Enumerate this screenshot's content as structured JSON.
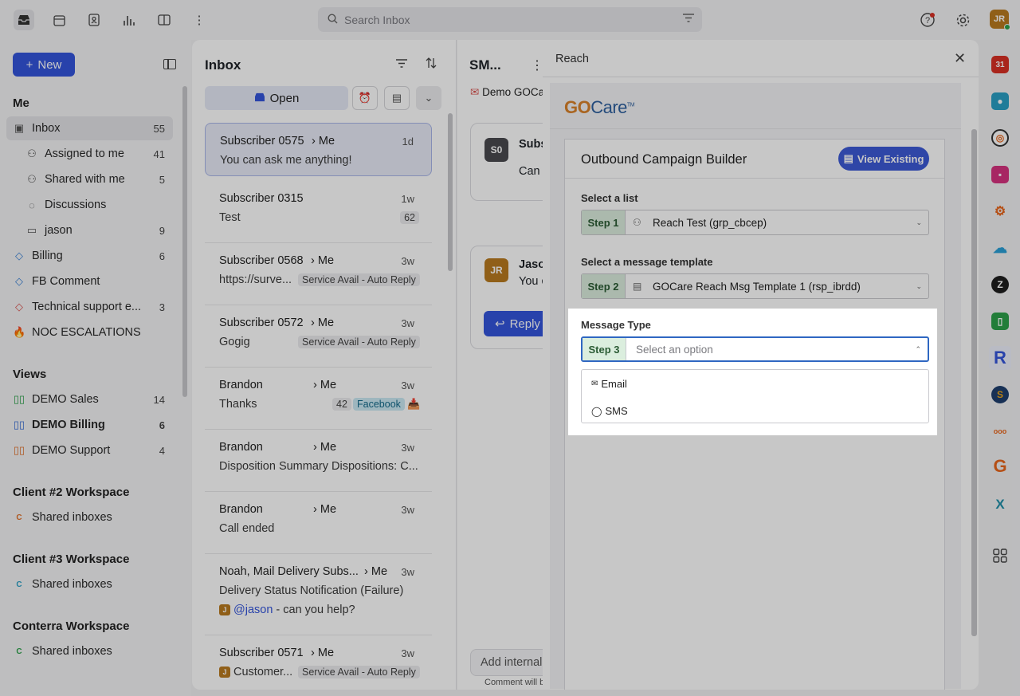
{
  "topbar": {
    "search_placeholder": "Search Inbox",
    "user_initials": "JR"
  },
  "sidebar": {
    "new_label": "New",
    "me_title": "Me",
    "me_items": [
      {
        "label": "Inbox",
        "count": "55"
      },
      {
        "label": "Assigned to me",
        "count": "41"
      },
      {
        "label": "Shared with me",
        "count": "5"
      },
      {
        "label": "Discussions",
        "count": ""
      },
      {
        "label": "jason",
        "count": "9"
      },
      {
        "label": "Billing",
        "count": "6"
      },
      {
        "label": "FB Comment",
        "count": ""
      },
      {
        "label": "Technical support e...",
        "count": "3"
      },
      {
        "label": "NOC ESCALATIONS",
        "count": ""
      }
    ],
    "views_title": "Views",
    "views": [
      {
        "label": "DEMO Sales",
        "count": "14"
      },
      {
        "label": "DEMO Billing",
        "count": "6"
      },
      {
        "label": "DEMO Support",
        "count": "4"
      }
    ],
    "workspaces": [
      {
        "title": "Client #2 Workspace",
        "item": "Shared inboxes",
        "letter": "C",
        "color": "#e0702a"
      },
      {
        "title": "Client #3 Workspace",
        "item": "Shared inboxes",
        "letter": "C",
        "color": "#2a9fc4"
      },
      {
        "title": "Conterra Workspace",
        "item": "Shared inboxes",
        "letter": "C",
        "color": "#2ca14a"
      }
    ]
  },
  "inbox": {
    "title": "Inbox",
    "open_label": "Open",
    "messages": [
      {
        "from": "Subscriber 0575",
        "to": "Me",
        "time": "1d",
        "preview": "You can ask me anything!"
      },
      {
        "from": "Subscriber 0315",
        "to": "",
        "time": "1w",
        "preview": "Test",
        "count": "62"
      },
      {
        "from": "Subscriber 0568",
        "to": "Me",
        "time": "3w",
        "preview": "https://surve...",
        "tag": "Service Avail - Auto Reply"
      },
      {
        "from": "Subscriber 0572",
        "to": "Me",
        "time": "3w",
        "preview": "Gogig",
        "tag": "Service Avail - Auto Reply"
      },
      {
        "from": "Brandon",
        "to": "Me",
        "time": "3w",
        "preview": "Thanks",
        "count": "42",
        "tag": "Facebook"
      },
      {
        "from": "Brandon",
        "to": "Me",
        "time": "3w",
        "preview": "Disposition Summary Dispositions: C..."
      },
      {
        "from": "Brandon",
        "to": "Me",
        "time": "3w",
        "preview": "Call ended"
      },
      {
        "from": "Noah, Mail Delivery Subs...",
        "to": "Me",
        "time": "3w",
        "preview": "Delivery Status Notification (Failure)",
        "mention": "@jason",
        "mention_rest": " - can you help?",
        "badge": "J"
      },
      {
        "from": "Subscriber 0571",
        "to": "Me",
        "time": "3w",
        "preview": "Customer...",
        "tag": "Service Avail - Auto Reply",
        "badge": "J"
      }
    ]
  },
  "conversation": {
    "title": "SM...",
    "subject": "Demo GOCare",
    "card1_initials": "S0",
    "card1_name": "Subs",
    "card1_text": "Can",
    "card2_initials": "JR",
    "card2_name": "Jaso",
    "card2_text": "You c",
    "reply_label": "Reply",
    "add_internal": "Add internal",
    "comment_note": "Comment will b"
  },
  "reach": {
    "title": "Reach",
    "logo_go": "GO",
    "logo_care": "Care",
    "logo_tm": "TM",
    "builder_title": "Outbound Campaign Builder",
    "view_existing": "View Existing",
    "list_label": "Select a list",
    "step1": "Step 1",
    "list_value": "Reach Test (grp_cbcep)",
    "template_label": "Select a message template",
    "step2": "Step 2",
    "template_value": "GOCare Reach Msg Template 1 (rsp_ibrdd)",
    "type_label": "Message Type",
    "step3": "Step 3",
    "type_placeholder": "Select an option",
    "options": [
      "Email",
      "SMS"
    ]
  },
  "rail_apps": [
    "31",
    "R",
    "S",
    "G",
    "X"
  ]
}
